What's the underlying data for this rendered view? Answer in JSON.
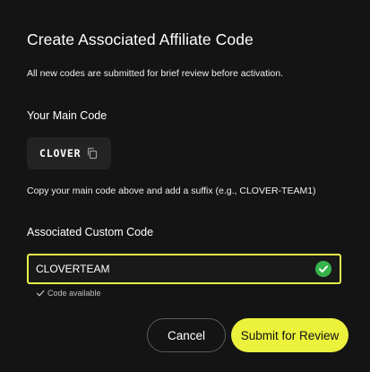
{
  "dialog": {
    "title": "Create Associated Affiliate Code",
    "subtitle": "All new codes are submitted for brief review before activation."
  },
  "main_code": {
    "label": "Your Main Code",
    "value": "CLOVER",
    "copy_icon": "copy-icon"
  },
  "hint": "Copy your main code above and add a suffix (e.g., CLOVER-TEAM1)",
  "custom_code": {
    "label": "Associated Custom Code",
    "value": "CLOVERTEAM",
    "status_icon": "check-circle-icon",
    "status_color": "#35b34a",
    "availability": "Code available"
  },
  "actions": {
    "cancel_label": "Cancel",
    "submit_label": "Submit for Review",
    "accent_color": "#ecf23c"
  }
}
